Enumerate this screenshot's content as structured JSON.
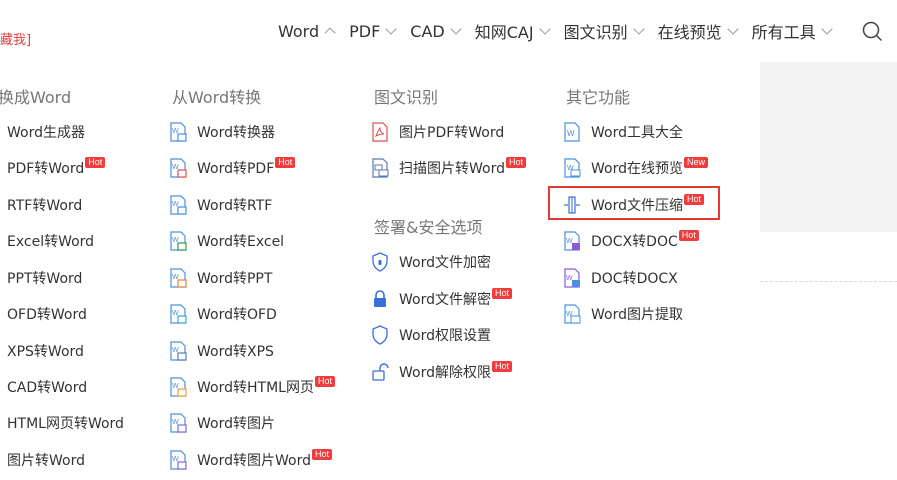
{
  "header": {
    "bookmark_text": "藏我]",
    "nav": [
      {
        "label": "Word",
        "open": true
      },
      {
        "label": "PDF",
        "open": false
      },
      {
        "label": "CAD",
        "open": false
      },
      {
        "label": "知网CAJ",
        "open": false
      },
      {
        "label": "图文识别",
        "open": false
      },
      {
        "label": "在线预览",
        "open": false
      },
      {
        "label": "所有工具",
        "open": false
      }
    ],
    "search_icon": "search-icon"
  },
  "menu": {
    "col1": {
      "heading": "换成Word",
      "items": [
        {
          "label": "Word生成器",
          "badge": ""
        },
        {
          "label": "PDF转Word",
          "badge": "Hot"
        },
        {
          "label": "RTF转Word",
          "badge": ""
        },
        {
          "label": "Excel转Word",
          "badge": ""
        },
        {
          "label": "PPT转Word",
          "badge": ""
        },
        {
          "label": "OFD转Word",
          "badge": ""
        },
        {
          "label": "XPS转Word",
          "badge": ""
        },
        {
          "label": "CAD转Word",
          "badge": ""
        },
        {
          "label": "HTML网页转Word",
          "badge": ""
        },
        {
          "label": "图片转Word",
          "badge": ""
        }
      ]
    },
    "col2": {
      "heading": "从Word转换",
      "items": [
        {
          "label": "Word转换器",
          "badge": "",
          "icon_color": "#4a90e2"
        },
        {
          "label": "Word转PDF",
          "badge": "Hot",
          "icon_color": "#e05050"
        },
        {
          "label": "Word转RTF",
          "badge": "",
          "icon_color": "#4a90e2"
        },
        {
          "label": "Word转Excel",
          "badge": "",
          "icon_color": "#2e9e4f"
        },
        {
          "label": "Word转PPT",
          "badge": "",
          "icon_color": "#e8823a"
        },
        {
          "label": "Word转OFD",
          "badge": "",
          "icon_color": "#3aa8d8"
        },
        {
          "label": "Word转XPS",
          "badge": "",
          "icon_color": "#5a7ab0"
        },
        {
          "label": "Word转HTML网页",
          "badge": "Hot",
          "icon_color": "#e8a03a"
        },
        {
          "label": "Word转图片",
          "badge": "",
          "icon_color": "#7a6ad8"
        },
        {
          "label": "Word转图片Word",
          "badge": "Hot",
          "icon_color": "#7a6ad8"
        }
      ]
    },
    "col3": {
      "heading": "图文识别",
      "items": [
        {
          "label": "图片PDF转Word",
          "badge": ""
        },
        {
          "label": "扫描图片转Word",
          "badge": "Hot"
        }
      ],
      "heading2": "签署&安全选项",
      "security": [
        {
          "label": "Word文件加密",
          "badge": "",
          "icon": "shield-lock-icon"
        },
        {
          "label": "Word文件解密",
          "badge": "Hot",
          "icon": "lock-icon"
        },
        {
          "label": "Word权限设置",
          "badge": "",
          "icon": "shield-icon"
        },
        {
          "label": "Word解除权限",
          "badge": "Hot",
          "icon": "unlock-icon"
        }
      ]
    },
    "col4": {
      "heading": "其它功能",
      "items": [
        {
          "label": "Word工具大全",
          "badge": ""
        },
        {
          "label": "Word在线预览",
          "badge": "New"
        },
        {
          "label": "Word文件压缩",
          "badge": "Hot",
          "highlighted": true
        },
        {
          "label": "DOCX转DOC",
          "badge": "Hot"
        },
        {
          "label": "DOC转DOCX",
          "badge": ""
        },
        {
          "label": "Word图片提取",
          "badge": ""
        }
      ]
    }
  }
}
